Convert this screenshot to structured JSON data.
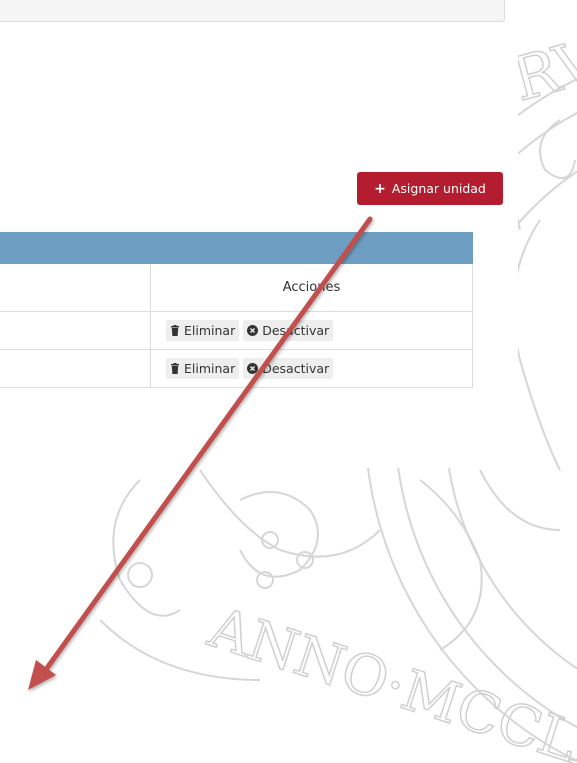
{
  "header": {
    "assign_button_label": "Asignar unidad",
    "assign_button_icon": "plus-icon"
  },
  "table": {
    "columns": [
      "",
      "Acciones"
    ],
    "rows": [
      {
        "actions": [
          {
            "label": "Eliminar",
            "icon": "trash-icon"
          },
          {
            "label": "Desactivar",
            "icon": "circle-x-icon"
          }
        ]
      },
      {
        "actions": [
          {
            "label": "Eliminar",
            "icon": "trash-icon"
          },
          {
            "label": "Desactivar",
            "icon": "circle-x-icon"
          }
        ]
      }
    ]
  },
  "background": {
    "seal_text": "ANNO·MCCLX"
  },
  "colors": {
    "primary_button": "#b41d2f",
    "table_band": "#6e9ec1",
    "arrow": "#c0504d"
  }
}
